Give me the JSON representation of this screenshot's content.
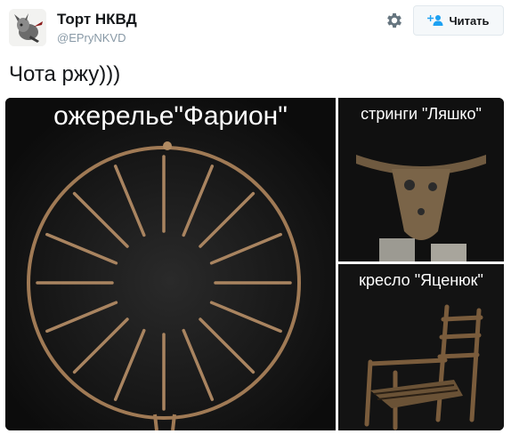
{
  "tweet": {
    "display_name": "Торт НКВД",
    "username": "@EPryNKVD",
    "text": "Чота ржу)))",
    "follow_label": "Читать"
  },
  "media": {
    "main_caption": "ожерелье\"Фарион\"",
    "top_right_caption": "стринги \"Ляшко\"",
    "bottom_right_caption": "кресло \"Яценюк\""
  },
  "icons": {
    "settings": "gear-icon",
    "follow": "add-user-icon"
  },
  "colors": {
    "text": "#14171a",
    "muted": "#8899a6",
    "button_bg": "#f5f8fa",
    "follow_icon": "#1da1f2"
  }
}
